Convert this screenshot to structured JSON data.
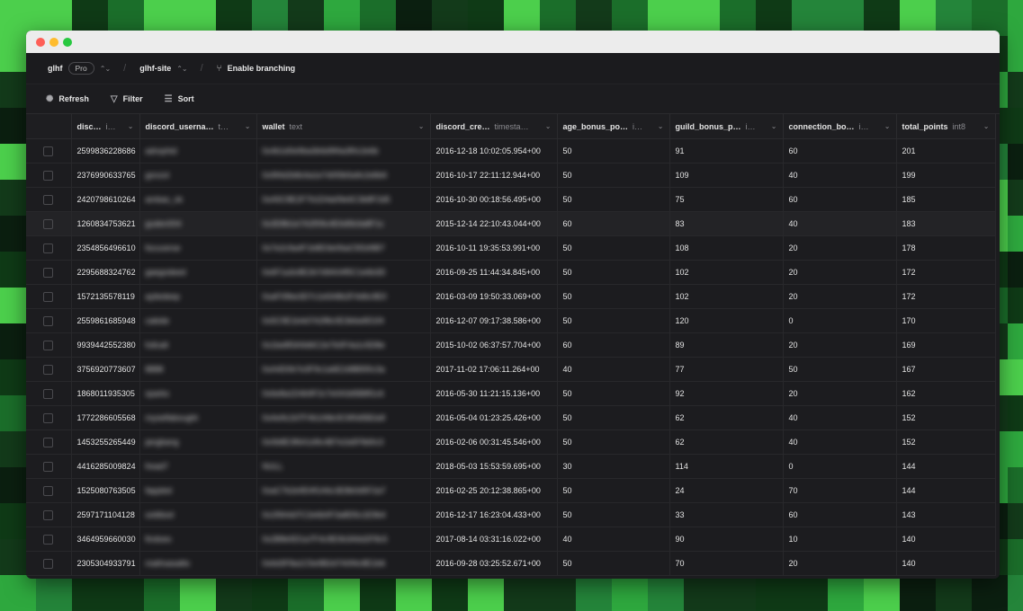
{
  "colors": {
    "background_greens": [
      "#0f3a16",
      "#1b6e2a",
      "#2ea83e",
      "#4ccf4c",
      "#133a1a",
      "#0b1f10",
      "#24853a"
    ],
    "window_bg": "#1c1c1f",
    "titlebar": "#ececec"
  },
  "topbar": {
    "project": "glhf",
    "plan": "Pro",
    "separator": "/",
    "branch": "glhf-site",
    "enable_branching": "Enable branching"
  },
  "toolbar": {
    "refresh": "Refresh",
    "filter": "Filter",
    "sort": "Sort"
  },
  "columns": [
    {
      "name": "disc…",
      "type": "i…"
    },
    {
      "name": "discord_userna…",
      "type": "t…"
    },
    {
      "name": "wallet",
      "type": "text"
    },
    {
      "name": "discord_cre…",
      "type": "timesta…"
    },
    {
      "name": "age_bonus_po…",
      "type": "i…"
    },
    {
      "name": "guild_bonus_p…",
      "type": "i…"
    },
    {
      "name": "connection_bo…",
      "type": "i…"
    },
    {
      "name": "total_points",
      "type": "int8"
    }
  ],
  "rows": [
    {
      "id": "2599836228686",
      "username": "adrophid",
      "wallet": "0x4b1d0e9ba3b6d9f4a3f0c2e6b",
      "created": "2016-12-18 10:02:05.954+00",
      "age": "50",
      "guild": "91",
      "connection": "60",
      "total": "201"
    },
    {
      "id": "2376990633765",
      "username": "gonzol",
      "wallet": "0x9f4d2b8c6a1e7d0f3b5a9c2e8d4",
      "created": "2016-10-17 22:11:12.944+00",
      "age": "50",
      "guild": "109",
      "connection": "40",
      "total": "199"
    },
    {
      "id": "2420798610264",
      "username": "ambas_ok",
      "wallet": "0xA5C8E2F7b1D4a09e6C3b8F2d5",
      "created": "2016-10-30 00:18:56.495+00",
      "age": "50",
      "guild": "75",
      "connection": "60",
      "total": "185"
    },
    {
      "id": "1260834753621",
      "username": "guden004",
      "wallet": "0x3D8b1e7A2f09c4E6d5b3a8F1c",
      "created": "2015-12-14 22:10:43.044+00",
      "age": "60",
      "guild": "83",
      "connection": "40",
      "total": "183"
    },
    {
      "id": "2354856496610",
      "username": "focuverse",
      "wallet": "0x7e2c9a4F1b8D3e06aC5f2d9B7",
      "created": "2016-10-11 19:35:53.991+00",
      "age": "50",
      "guild": "108",
      "connection": "20",
      "total": "178"
    },
    {
      "id": "2295688324762",
      "username": "gaegodeed",
      "wallet": "0x6F1a3c8E2b7d9A04f5C1e6b3D",
      "created": "2016-09-25 11:44:34.845+00",
      "age": "50",
      "guild": "102",
      "connection": "20",
      "total": "172"
    },
    {
      "id": "1572135578119",
      "username": "ayliedeep",
      "wallet": "0xaF09be3D7c1e5A8b2F4d6c9E0",
      "created": "2016-03-09 19:50:33.069+00",
      "age": "50",
      "guild": "102",
      "connection": "20",
      "total": "172"
    },
    {
      "id": "2559861685948",
      "username": "cabide",
      "wallet": "0x5C9E1b4d7A2f8c0E3b6a9D1f4",
      "created": "2016-12-07 09:17:38.586+00",
      "age": "50",
      "guild": "120",
      "connection": "0",
      "total": "170"
    },
    {
      "id": "9939442552380",
      "username": "fullcalt",
      "wallet": "0x1be8f3A9d6C2e7b0F4a1c5D8e",
      "created": "2015-10-02 06:37:57.704+00",
      "age": "60",
      "guild": "89",
      "connection": "20",
      "total": "169"
    },
    {
      "id": "3756920773607",
      "username": "8888",
      "wallet": "0xA4D0b7e3F9c1a6E2d8B5f0c3a",
      "created": "2017-11-02 17:06:11.264+00",
      "age": "40",
      "guild": "77",
      "connection": "50",
      "total": "167"
    },
    {
      "id": "1868011935305",
      "username": "sparks",
      "wallet": "0x6e8a1D4b9F2c7e0A3d5B8f1c6",
      "created": "2016-05-30 11:21:15.136+00",
      "age": "50",
      "guild": "92",
      "connection": "20",
      "total": "162"
    },
    {
      "id": "1772286605568",
      "username": "myselfabought",
      "wallet": "0xAe9c2d7F4b1A8e3C6f0d5B2a9",
      "created": "2016-05-04 01:23:25.426+00",
      "age": "50",
      "guild": "62",
      "connection": "40",
      "total": "152"
    },
    {
      "id": "1453255265449",
      "username": "jangbang",
      "wallet": "0x0b8E3f6A1d9c4B7e2a5F8d0c3",
      "created": "2016-02-06 00:31:45.546+00",
      "age": "50",
      "guild": "62",
      "connection": "40",
      "total": "152"
    },
    {
      "id": "4416285009824",
      "username": "fread7",
      "wallet": "NULL",
      "created": "2018-05-03 15:53:59.695+00",
      "age": "30",
      "guild": "114",
      "connection": "0",
      "total": "144"
    },
    {
      "id": "1525080763505",
      "username": "fappled",
      "wallet": "0xaC7b2e9D4f1A6c3E8b0d5F2a7",
      "created": "2016-02-25 20:12:38.865+00",
      "age": "50",
      "guild": "24",
      "connection": "70",
      "total": "144"
    },
    {
      "id": "2597171104128",
      "username": "sottibod",
      "wallet": "0x1f9A4d7C2e6b0F3a8D5c1E9b4",
      "created": "2016-12-17 16:23:04.433+00",
      "age": "50",
      "guild": "33",
      "connection": "60",
      "total": "143"
    },
    {
      "id": "3464959660030",
      "username": "findoes",
      "wallet": "0x2B8e5D1a7F4c9E0b3A6d2F8c5",
      "created": "2017-08-14 03:31:16.022+00",
      "age": "40",
      "guild": "90",
      "connection": "10",
      "total": "140"
    },
    {
      "id": "2305304933791",
      "username": "mathsasaltic",
      "wallet": "0x6d3F8a1C5e9B2d7A0f4c8E1b6",
      "created": "2016-09-28 03:25:52.671+00",
      "age": "50",
      "guild": "70",
      "connection": "20",
      "total": "140"
    }
  ]
}
